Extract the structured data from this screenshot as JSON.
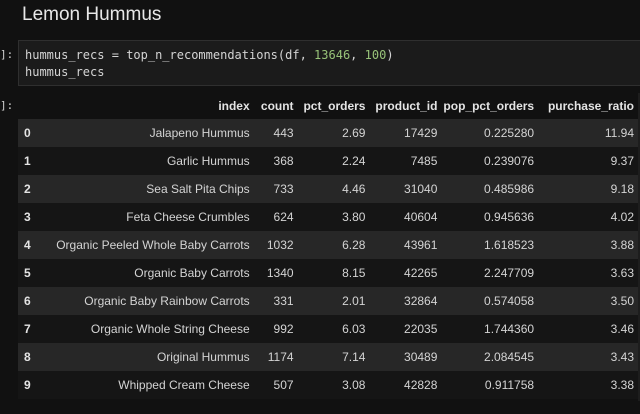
{
  "title": "Lemon Hummus",
  "cell": {
    "in_prompt": "]:",
    "out_prompt": "]:",
    "code": {
      "line1_var": "hummus_recs",
      "line1_eq": "=",
      "line1_func": "top_n_recommendations(df,",
      "line1_arg1": "13646",
      "line1_comma": ",",
      "line1_arg2": "100",
      "line1_close": ")",
      "line2": "hummus_recs"
    }
  },
  "table": {
    "columns": [
      "index",
      "count",
      "pct_orders",
      "product_id",
      "pop_pct_orders",
      "purchase_ratio"
    ],
    "rows": [
      {
        "idx": "0",
        "index": "Jalapeno Hummus",
        "count": "443",
        "pct_orders": "2.69",
        "product_id": "17429",
        "pop_pct_orders": "0.225280",
        "purchase_ratio": "11.94"
      },
      {
        "idx": "1",
        "index": "Garlic Hummus",
        "count": "368",
        "pct_orders": "2.24",
        "product_id": "7485",
        "pop_pct_orders": "0.239076",
        "purchase_ratio": "9.37"
      },
      {
        "idx": "2",
        "index": "Sea Salt Pita Chips",
        "count": "733",
        "pct_orders": "4.46",
        "product_id": "31040",
        "pop_pct_orders": "0.485986",
        "purchase_ratio": "9.18"
      },
      {
        "idx": "3",
        "index": "Feta Cheese Crumbles",
        "count": "624",
        "pct_orders": "3.80",
        "product_id": "40604",
        "pop_pct_orders": "0.945636",
        "purchase_ratio": "4.02"
      },
      {
        "idx": "4",
        "index": "Organic Peeled Whole Baby Carrots",
        "count": "1032",
        "pct_orders": "6.28",
        "product_id": "43961",
        "pop_pct_orders": "1.618523",
        "purchase_ratio": "3.88"
      },
      {
        "idx": "5",
        "index": "Organic Baby Carrots",
        "count": "1340",
        "pct_orders": "8.15",
        "product_id": "42265",
        "pop_pct_orders": "2.247709",
        "purchase_ratio": "3.63"
      },
      {
        "idx": "6",
        "index": "Organic Baby Rainbow Carrots",
        "count": "331",
        "pct_orders": "2.01",
        "product_id": "32864",
        "pop_pct_orders": "0.574058",
        "purchase_ratio": "3.50"
      },
      {
        "idx": "7",
        "index": "Organic Whole String Cheese",
        "count": "992",
        "pct_orders": "6.03",
        "product_id": "22035",
        "pop_pct_orders": "1.744360",
        "purchase_ratio": "3.46"
      },
      {
        "idx": "8",
        "index": "Original Hummus",
        "count": "1174",
        "pct_orders": "7.14",
        "product_id": "30489",
        "pop_pct_orders": "2.084545",
        "purchase_ratio": "3.43"
      },
      {
        "idx": "9",
        "index": "Whipped Cream Cheese",
        "count": "507",
        "pct_orders": "3.08",
        "product_id": "42828",
        "pop_pct_orders": "0.911758",
        "purchase_ratio": "3.38"
      }
    ]
  }
}
